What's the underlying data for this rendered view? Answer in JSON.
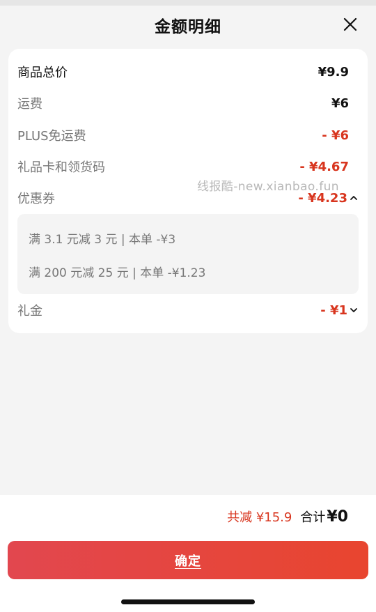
{
  "header": {
    "title": "金额明细"
  },
  "rows": [
    {
      "label": "商品总价",
      "value": "¥9.9"
    },
    {
      "label": "运费",
      "value": "¥6"
    },
    {
      "label": "PLUS免运费",
      "value": "- ¥6"
    },
    {
      "label": "礼品卡和领货码",
      "value": "- ¥4.67"
    },
    {
      "label": "优惠券",
      "value": "- ¥4.23"
    },
    {
      "label": "礼金",
      "value": "- ¥1"
    }
  ],
  "coupons": [
    "满 3.1 元减 3 元 | 本单 -¥3",
    "满 200 元减 25 元 | 本单 -¥1.23"
  ],
  "watermark": "线报酷-new.xianbao.fun",
  "footer": {
    "save_text": "共减 ¥15.9",
    "total_label": "合计",
    "total_value": "¥0",
    "confirm_label": "确定"
  },
  "colors": {
    "accent": "#d8351e",
    "button_start": "#e2474f",
    "button_end": "#e8452f"
  }
}
